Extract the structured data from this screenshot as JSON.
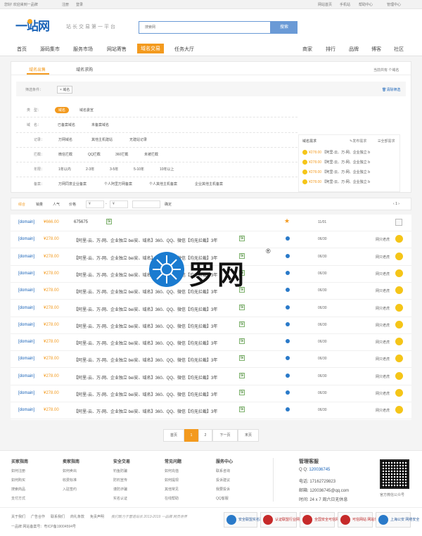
{
  "topbar": {
    "welcome": "您好! 欢迎来到一品牌",
    "register": "注册",
    "login": "登录",
    "right_links": [
      "网站首页",
      "手机站",
      "帮助中心",
      "管理中心"
    ]
  },
  "header": {
    "logo": "一站网",
    "slogan": "站长交易第一平台",
    "search_placeholder": "搜索网",
    "search_button": "搜索"
  },
  "nav": {
    "items": [
      "首页",
      "源码集市",
      "服务市场",
      "网站寄售",
      "域名交易",
      "任务大厅"
    ],
    "active_index": 4,
    "right_items": [
      "商家",
      "排行",
      "品牌",
      "博客",
      "社区"
    ]
  },
  "filter": {
    "tabs": [
      "域名出售",
      "域名求购"
    ],
    "count_text": "当前共有 个域名",
    "conditions_label": "筛选条件：",
    "condition_tag": "× 域名",
    "clear_label": "清除筛选",
    "type": {
      "label": "类　型：",
      "options": [
        "域名",
        "域名委宣"
      ]
    },
    "domain": {
      "label": "域　名：",
      "options": [
        "已备案域名",
        "未备案域名"
      ]
    },
    "record": {
      "label": "记录：",
      "options": [
        "万网域名",
        "其他主机建站",
        "无建站记录"
      ]
    },
    "block": {
      "label": "拦截：",
      "options": [
        "微信拦截",
        "QQ拦截",
        "360拦截",
        "未被拦截"
      ]
    },
    "age": {
      "label": "年限：",
      "options": [
        "1年以内",
        "2-3年",
        "3-5年",
        "5-10年",
        "10年以上"
      ]
    },
    "beian": {
      "label": "备案：",
      "options": [
        "万网同意企业备案",
        "个人阿里万网备案",
        "个人其他主机备案",
        "企业其他主机备案"
      ]
    }
  },
  "demand": {
    "title": "域名需求",
    "publish": "发布需求",
    "all": "全部需求",
    "items": [
      {
        "price": "¥278.00",
        "text": "【阿里-云、万-网、企业独立 b"
      },
      {
        "price": "¥278.00",
        "text": "【阿里-云、万-网、企业独立 b"
      },
      {
        "price": "¥278.00",
        "text": "【阿里-云、万-网、企业独立 b"
      },
      {
        "price": "¥278.00",
        "text": "【阿里-云、万-网、企业独立 b"
      }
    ]
  },
  "sortbar": {
    "items": [
      "综合",
      "销量",
      "人气",
      "价格"
    ],
    "price_from": "¥",
    "price_to": "¥",
    "dash": "-",
    "confirm": "确定",
    "page_text": "1"
  },
  "listing": {
    "rows": [
      {
        "domain": "[domain]",
        "price": "¥666.00",
        "desc": "675675",
        "date": "11/01",
        "seller": "",
        "first": true
      },
      {
        "domain": "[domain]",
        "price": "¥278.00",
        "desc": "【阿里-云、万-网、企业独立 bei安、域名】360、QQ、微信【均无拦截】3年",
        "date": "06/30",
        "seller": "网只老虎"
      },
      {
        "domain": "[domain]",
        "price": "¥278.00",
        "desc": "【阿里-云、万-网、企业独立 bei安、域名】360、QQ、微信【均无拦截】3年",
        "date": "06/30",
        "seller": "网只老虎"
      },
      {
        "domain": "[domain]",
        "price": "¥278.00",
        "desc": "【阿里-云、万-网、企业独立 bei安、域名】360、QQ、微信【均无拦截】3年",
        "date": "06/30",
        "seller": "网只老虎"
      },
      {
        "domain": "[domain]",
        "price": "¥278.00",
        "desc": "【阿里-云、万-网、企业独立 bei安、域名】360、QQ、微信【均无拦截】3年",
        "date": "06/30",
        "seller": "网只老虎"
      },
      {
        "domain": "[domain]",
        "price": "¥278.00",
        "desc": "【阿里-云、万-网、企业独立 bei安、域名】360、QQ、微信【均无拦截】3年",
        "date": "06/30",
        "seller": "网只老虎"
      },
      {
        "domain": "[domain]",
        "price": "¥278.00",
        "desc": "【阿里-云、万-网、企业独立 bei安、域名】360、QQ、微信【均无拦截】3年",
        "date": "06/30",
        "seller": "网只老虎"
      },
      {
        "domain": "[domain]",
        "price": "¥278.00",
        "desc": "【阿里-云、万-网、企业独立 bei安、域名】360、QQ、微信【均无拦截】3年",
        "date": "06/30",
        "seller": "网只老虎"
      },
      {
        "domain": "[domain]",
        "price": "¥278.00",
        "desc": "【阿里-云、万-网、企业独立 bei安、域名】360、QQ、微信【均无拦截】3年",
        "date": "06/30",
        "seller": "网只老虎"
      },
      {
        "domain": "[domain]",
        "price": "¥278.00",
        "desc": "【阿里-云、万-网、企业独立 bei安、域名】360、QQ、微信【均无拦截】3年",
        "date": "06/30",
        "seller": "网只老虎"
      },
      {
        "domain": "[domain]",
        "price": "¥278.00",
        "desc": "【阿里-云、万-网、企业独立 bei安、域名】360、QQ、微信【均无拦截】3年",
        "date": "06/30",
        "seller": "网只老虎"
      },
      {
        "domain": "[domain]",
        "price": "¥278.00",
        "desc": "【阿里-云、万-网、企业独立 bei安、域名】360、QQ、微信【均无拦截】3年",
        "date": "06/30",
        "seller": "网只老虎"
      }
    ],
    "tick": "保"
  },
  "pagination": [
    "首页",
    "1",
    "2",
    "下一页",
    "末页"
  ],
  "watermark": {
    "text": "罗网",
    "reg": "®"
  },
  "footer": {
    "columns": [
      {
        "title": "买家指南",
        "links": [
          "如何注册",
          "如何购买",
          "搜索商品",
          "支付方式"
        ]
      },
      {
        "title": "卖家指南",
        "links": [
          "如何卖出",
          "收费标准",
          "入驻签约"
        ]
      },
      {
        "title": "安全交易",
        "links": [
          "钓鱼防骗",
          "防钓宣传",
          "谨防诈骗",
          "实名认证"
        ]
      },
      {
        "title": "常见问题",
        "links": [
          "如何充值",
          "如何提现",
          "其他常见",
          "在线帮助"
        ]
      },
      {
        "title": "服务中心",
        "links": [
          "联系咨询",
          "投诉建议",
          "我要投诉",
          "QQ客服"
        ]
      }
    ],
    "contact": {
      "title": "管理客服",
      "qq_label": "Q Q:",
      "qq": "120036745",
      "phone_label": "电话:",
      "phone": "17162729823",
      "email_label": "邮箱:",
      "email": "120036745@qq.com",
      "hours_label": "时间:",
      "hours": "24 x 7 周六日无休息"
    },
    "qr_caption": "官方微信公众号",
    "bottom_links": [
      "关于我们",
      "广告合作",
      "联系我们",
      "商礼条款",
      "免责声明"
    ],
    "slogan_line": "我们致力于营造站长 2013-2019 一品牌 网员世界",
    "icp": "一品牌 网站备案号：粤ICP备19004594号",
    "badges": [
      "安全联盟实名验证",
      "认证联盟行业网站",
      "全国安全可信网站",
      "可信网站 网站信用",
      "上海公安 网络安全"
    ]
  }
}
